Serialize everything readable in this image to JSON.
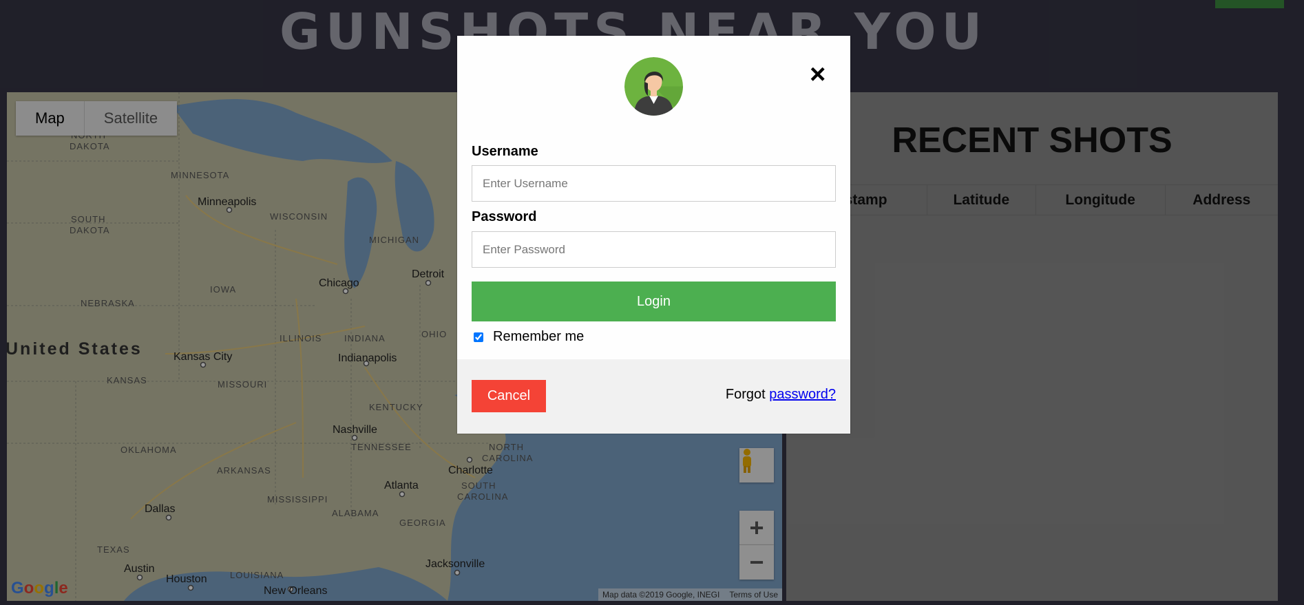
{
  "page": {
    "title": "GUNSHOTS NEAR YOU"
  },
  "map": {
    "type_control": {
      "map_label": "Map",
      "satellite_label": "Satellite",
      "selected": "Map"
    },
    "labels": {
      "north_dakota": [
        "NORTH",
        "DAKOTA"
      ],
      "south_dakota": [
        "SOUTH",
        "DAKOTA"
      ],
      "north_carolina": [
        "NORTH",
        "CAROLINA"
      ],
      "south_carolina": [
        "SOUTH",
        "CAROLINA"
      ],
      "minnesota": "MINNESOTA",
      "wisconsin": "WISCONSIN",
      "michigan": "MICHIGAN",
      "iowa": "IOWA",
      "nebraska": "NEBRASKA",
      "illinois": "ILLINOIS",
      "indiana": "INDIANA",
      "ohio": "OHIO",
      "kansas": "KANSAS",
      "missouri": "MISSOURI",
      "kentucky": "KENTUCKY",
      "tennessee": "TENNESSEE",
      "oklahoma": "OKLAHOMA",
      "arkansas": "ARKANSAS",
      "mississippi": "MISSISSIPPI",
      "alabama": "ALABAMA",
      "georgia": "GEORGIA",
      "texas": "TEXAS",
      "louisiana": "LOUISIANA",
      "country": "United States",
      "minneapolis": "Minneapolis",
      "chicago": "Chicago",
      "detroit": "Detroit",
      "kansas_city": "Kansas City",
      "indianapolis": "Indianapolis",
      "nashville": "Nashville",
      "charlotte": "Charlotte",
      "atlanta": "Atlanta",
      "dallas": "Dallas",
      "austin": "Austin",
      "houston": "Houston",
      "new_orleans": "New Orleans",
      "jacksonville": "Jacksonville"
    },
    "credit": "Map data ©2019 Google, INEGI",
    "terms": "Terms of Use",
    "logo": "Google",
    "zoom_in": "+",
    "zoom_out": "−"
  },
  "recent_shots": {
    "title": "RECENT SHOTS",
    "columns": [
      "estamp",
      "Latitude",
      "Longitude",
      "Address"
    ]
  },
  "login_modal": {
    "close_glyph": "×",
    "avatar_icon": "user-avatar-icon",
    "username_label": "Username",
    "username_placeholder": "Enter Username",
    "password_label": "Password",
    "password_placeholder": "Enter Password",
    "login_label": "Login",
    "remember_label": "Remember me",
    "remember_checked": true,
    "cancel_label": "Cancel",
    "forgot_text": "Forgot",
    "forgot_link": "password?"
  },
  "colors": {
    "background": "#363545",
    "login_green": "#4caf50",
    "cancel_red": "#f44336",
    "link_blue": "#0000ee"
  }
}
